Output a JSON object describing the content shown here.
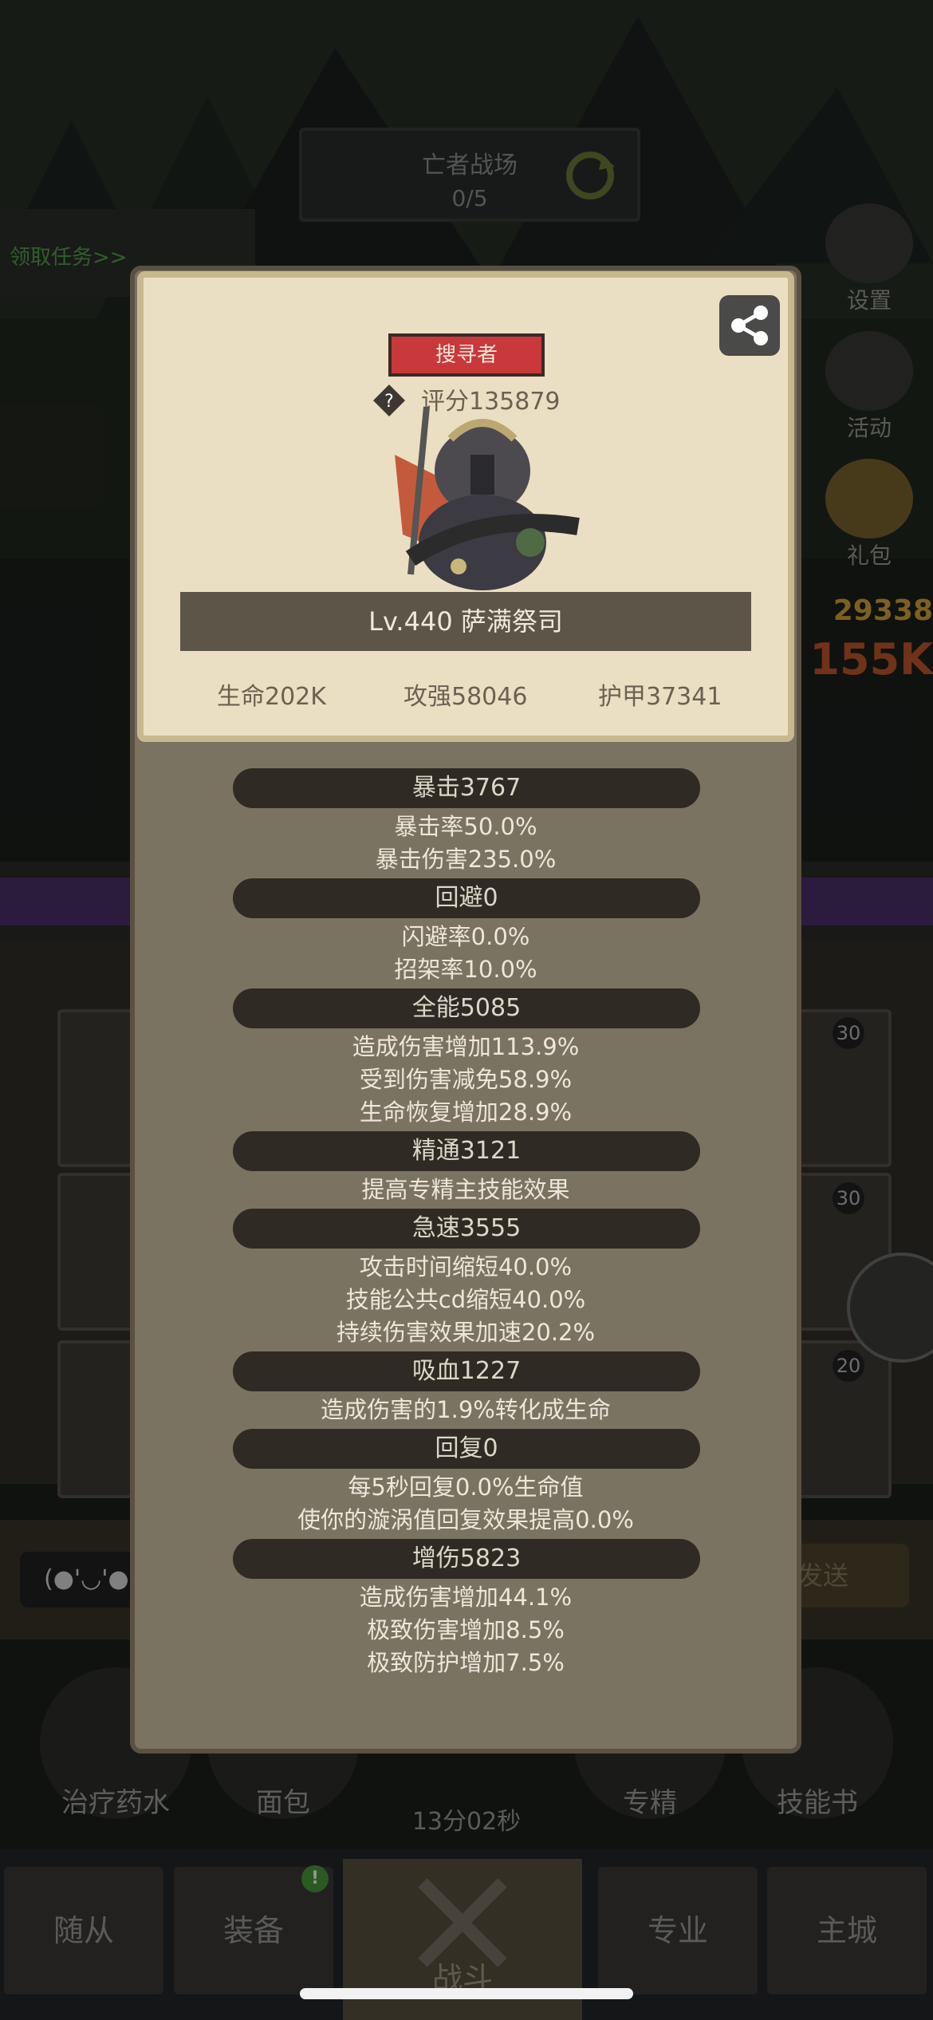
{
  "background": {
    "banner_title": "亡者战场",
    "banner_progress": "0/5",
    "quest_link": "领取任务>>",
    "side_buttons": [
      "设置",
      "活动",
      "礼包"
    ],
    "side_number_1": "29338",
    "side_number_2": "155K",
    "slot_badges": [
      "30",
      "30",
      "20"
    ],
    "chat_emoji": "(●'◡'●",
    "send_label": "发送",
    "round_buttons": [
      "治疗药水",
      "面包",
      "专精",
      "技能书"
    ],
    "timer": "13分02秒",
    "tabs": [
      "随从",
      "装备",
      "战斗",
      "专业",
      "主城"
    ],
    "notify_badge": "!"
  },
  "panel": {
    "title_badge": "搜寻者",
    "score": "评分135879",
    "name": "Lv.440 萨满祭司",
    "base_stats": [
      "生命202K",
      "攻强58046",
      "护甲37341"
    ],
    "groups": [
      {
        "header": "暴击3767",
        "lines": [
          "暴击率50.0%",
          "暴击伤害235.0%"
        ]
      },
      {
        "header": "回避0",
        "lines": [
          "闪避率0.0%",
          "招架率10.0%"
        ]
      },
      {
        "header": "全能5085",
        "lines": [
          "造成伤害增加113.9%",
          "受到伤害减免58.9%",
          "生命恢复增加28.9%"
        ]
      },
      {
        "header": "精通3121",
        "lines": [
          "提高专精主技能效果"
        ]
      },
      {
        "header": "急速3555",
        "lines": [
          "攻击时间缩短40.0%",
          "技能公共cd缩短40.0%",
          "持续伤害效果加速20.2%"
        ]
      },
      {
        "header": "吸血1227",
        "lines": [
          "造成伤害的1.9%转化成生命"
        ]
      },
      {
        "header": "回复0",
        "lines": [
          "每5秒回复0.0%生命值",
          "使你的漩涡值回复效果提高0.0%"
        ]
      },
      {
        "header": "增伤5823",
        "lines": [
          "造成伤害增加44.1%",
          "极致伤害增加8.5%",
          "极致防护增加7.5%"
        ]
      }
    ]
  }
}
